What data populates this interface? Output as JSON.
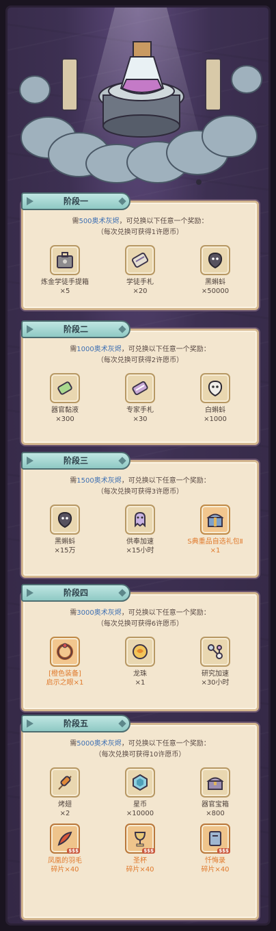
{
  "stages": [
    {
      "title": "阶段一",
      "line1_pre": "需",
      "line1_cost": "500奥术灰烬",
      "line1_post": "，可兑换以下任意一个奖励：",
      "line2": "（每次兑换可获得1许愿币）",
      "rewards": [
        {
          "name": "炼金学徒手提箱",
          "count": "×5",
          "icon": "briefcase-icon"
        },
        {
          "name": "学徒手札",
          "count": "×20",
          "icon": "scroll-icon"
        },
        {
          "name": "黑蝌蚪",
          "count": "×50000",
          "icon": "black-tadpole-icon"
        }
      ]
    },
    {
      "title": "阶段二",
      "line1_pre": "需",
      "line1_cost": "1000奥术灰烬",
      "line1_post": "，可兑换以下任意一个奖励：",
      "line2": "（每次兑换可获得2许愿币）",
      "rewards": [
        {
          "name": "器官黏液",
          "count": "×300",
          "icon": "slime-vial-icon"
        },
        {
          "name": "专家手札",
          "count": "×30",
          "icon": "expert-scroll-icon"
        },
        {
          "name": "白蝌蚪",
          "count": "×1000",
          "icon": "white-tadpole-icon"
        }
      ]
    },
    {
      "title": "阶段三",
      "line1_pre": "需",
      "line1_cost": "1500奥术灰烬",
      "line1_post": "，可兑换以下任意一个奖励：",
      "line2": "（每次兑换可获得3许愿币）",
      "rewards": [
        {
          "name": "黑蝌蚪",
          "count": "×15万",
          "icon": "black-tadpole-icon"
        },
        {
          "name": "供奉加速",
          "count": "×15小时",
          "icon": "ghost-speedup-icon"
        },
        {
          "name": "S典重品自选礼包Ⅱ",
          "count": "×1",
          "icon": "gift-chest-icon",
          "highlight": true
        }
      ]
    },
    {
      "title": "阶段四",
      "line1_pre": "需",
      "line1_cost": "3000奥术灰烬",
      "line1_post": "，可兑换以下任意一个奖励：",
      "line2": "（每次兑换可获得6许愿币）",
      "rewards": [
        {
          "name": "[橙色装备]",
          "count": "启示之眼×1",
          "icon": "ring-icon",
          "highlight": true
        },
        {
          "name": "龙珠",
          "count": "×1",
          "icon": "dragon-orb-icon"
        },
        {
          "name": "研究加速",
          "count": "×30小时",
          "icon": "research-icon"
        }
      ]
    },
    {
      "title": "阶段五",
      "line1_pre": "需",
      "line1_cost": "5000奥术灰烬",
      "line1_post": "，可兑换以下任意一个奖励：",
      "line2": "（每次兑换可获得10许愿币）",
      "rewards": [
        {
          "name": "烤翅",
          "count": "×2",
          "icon": "skewer-icon"
        },
        {
          "name": "星币",
          "count": "×10000",
          "icon": "star-coin-icon"
        },
        {
          "name": "器官宝箱",
          "count": "×800",
          "icon": "treasure-chest-icon"
        },
        {
          "name": "凤凰的羽毛",
          "count": "碎片×40",
          "icon": "phoenix-feather-icon",
          "highlight": true,
          "rare": true
        },
        {
          "name": "圣杯",
          "count": "碎片×40",
          "icon": "grail-icon",
          "highlight": true,
          "rare": true
        },
        {
          "name": "忏悔录",
          "count": "碎片×40",
          "icon": "tome-icon",
          "highlight": true,
          "rare": true
        }
      ]
    }
  ]
}
